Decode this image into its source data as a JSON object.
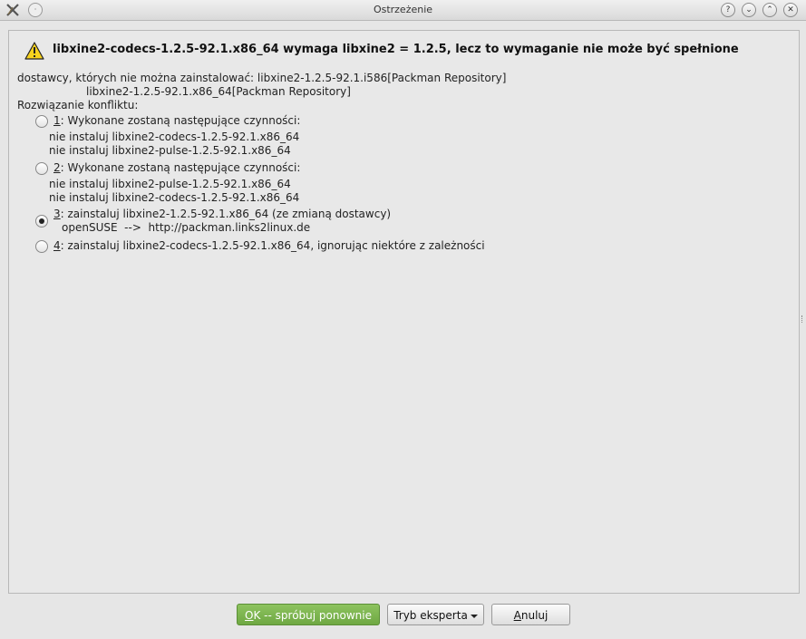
{
  "window": {
    "title": "Ostrzeżenie",
    "help_btn": "?",
    "collapse_btn": "⌄",
    "expand_btn": "⌃",
    "close_btn": "✕"
  },
  "headline": "libxine2-codecs-1.2.5-92.1.x86_64 wymaga libxine2 = 1.2.5, lecz to wymaganie nie może być spełnione",
  "details": {
    "line1": "dostawcy, których nie można zainstalować: libxine2-1.2.5-92.1.i586[Packman Repository]",
    "line2": "libxine2-1.2.5-92.1.x86_64[Packman Repository]",
    "line3": "Rozwiązanie konfliktu:"
  },
  "options": [
    {
      "key": "1",
      "label": ": Wykonane zostaną następujące czynności:",
      "sub": [
        "nie instaluj libxine2-codecs-1.2.5-92.1.x86_64",
        "nie instaluj libxine2-pulse-1.2.5-92.1.x86_64"
      ],
      "checked": false
    },
    {
      "key": "2",
      "label": ": Wykonane zostaną następujące czynności:",
      "sub": [
        "nie instaluj libxine2-pulse-1.2.5-92.1.x86_64",
        "nie instaluj libxine2-codecs-1.2.5-92.1.x86_64"
      ],
      "checked": false
    },
    {
      "key": "3",
      "label": ": zainstaluj libxine2-1.2.5-92.1.x86_64 (ze zmianą dostawcy)",
      "sub": [
        "openSUSE  -->  http://packman.links2linux.de"
      ],
      "checked": true
    },
    {
      "key": "4",
      "label": ": zainstaluj libxine2-codecs-1.2.5-92.1.x86_64, ignorując niektóre z zależności",
      "sub": [],
      "checked": false
    }
  ],
  "buttons": {
    "ok_mnemonic": "O",
    "ok_rest": "K -- spróbuj ponownie",
    "expert": "Tryb eksperta",
    "cancel_mnemonic": "A",
    "cancel_rest": "nuluj"
  },
  "colors": {
    "primary_button": "#7ab54d",
    "window_bg": "#e6e6e6"
  }
}
